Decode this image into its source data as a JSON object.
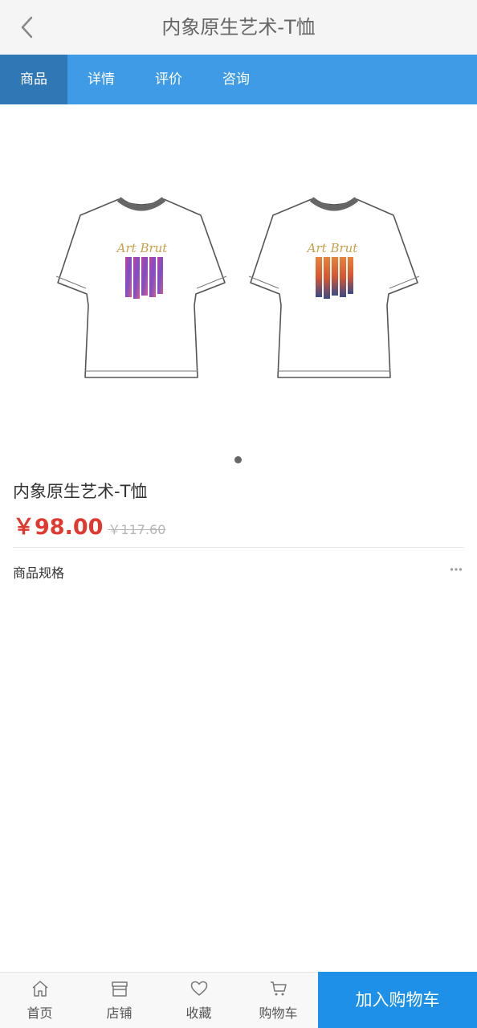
{
  "header": {
    "title": "内象原生艺术-T恤",
    "back_icon": "chevron-left-icon"
  },
  "tabs": [
    {
      "label": "商品",
      "active": true
    },
    {
      "label": "详情",
      "active": false
    },
    {
      "label": "评价",
      "active": false
    },
    {
      "label": "咨询",
      "active": false
    }
  ],
  "gallery": {
    "shirt_print_text": "Art Brut",
    "slide_count": 1,
    "current_slide": 1
  },
  "product": {
    "name": "内象原生艺术-T恤",
    "price": "￥98.00",
    "original_price": "￥117.60"
  },
  "spec": {
    "label": "商品规格",
    "more_icon": "more-dots-icon"
  },
  "bottom_bar": {
    "items": [
      {
        "label": "首页",
        "icon": "home-icon"
      },
      {
        "label": "店铺",
        "icon": "store-icon"
      },
      {
        "label": "收藏",
        "icon": "heart-icon"
      },
      {
        "label": "购物车",
        "icon": "cart-icon"
      }
    ],
    "add_to_cart": "加入购物车"
  },
  "colors": {
    "accent": "#3f9be6",
    "active_tab": "#2f78b5",
    "price": "#e0392f",
    "add_cart": "#1e90e8"
  }
}
